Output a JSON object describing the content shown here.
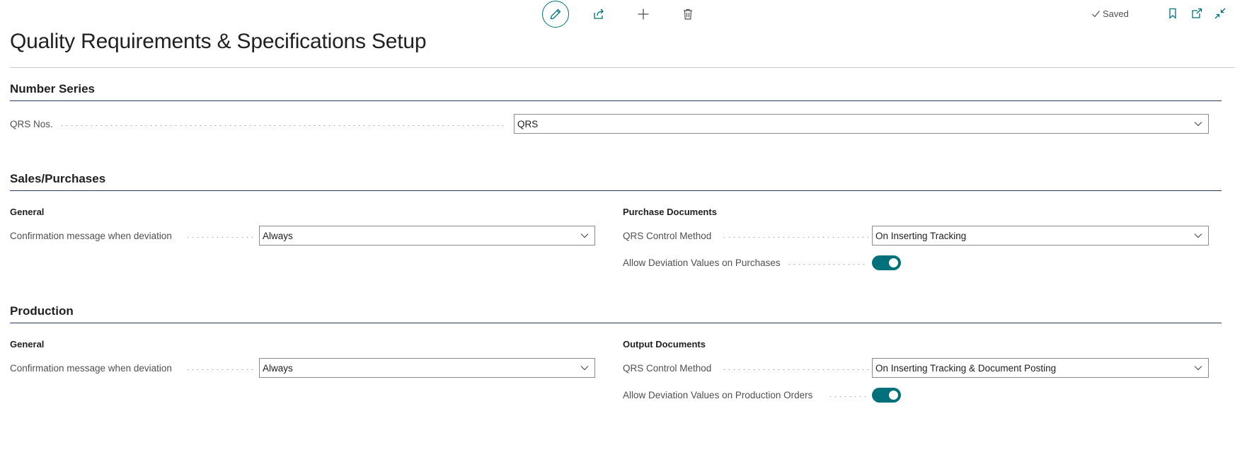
{
  "header": {
    "title": "Quality Requirements & Specifications Setup",
    "saved_text": "Saved"
  },
  "colors": {
    "accent": "#00707a",
    "section_rule": "#2a3b54",
    "label": "#505050"
  },
  "actions": {
    "edit_icon": "pencil-icon",
    "share_icon": "share-icon",
    "new_icon": "plus-icon",
    "delete_icon": "trash-icon",
    "bookmark_icon": "bookmark-icon",
    "open_new_window_icon": "open-new-window-icon",
    "collapse_icon": "collapse-icon"
  },
  "number_series": {
    "title": "Number Series",
    "qrs_nos_label": "QRS Nos.",
    "qrs_nos_value": "QRS"
  },
  "sales_purchases": {
    "title": "Sales/Purchases",
    "general_title": "General",
    "confirmation_label": "Confirmation message when deviation",
    "confirmation_value": "Always",
    "purchase_docs_title": "Purchase Documents",
    "qrs_control_label": "QRS Control Method",
    "qrs_control_value": "On Inserting Tracking",
    "allow_deviation_label": "Allow Deviation Values on Purchases",
    "allow_deviation_on": true
  },
  "production": {
    "title": "Production",
    "general_title": "General",
    "confirmation_label": "Confirmation message when deviation",
    "confirmation_value": "Always",
    "output_docs_title": "Output Documents",
    "qrs_control_label": "QRS Control Method",
    "qrs_control_value": "On Inserting Tracking & Document Posting",
    "allow_deviation_label": "Allow Deviation Values on Production Orders",
    "allow_deviation_on": true
  }
}
